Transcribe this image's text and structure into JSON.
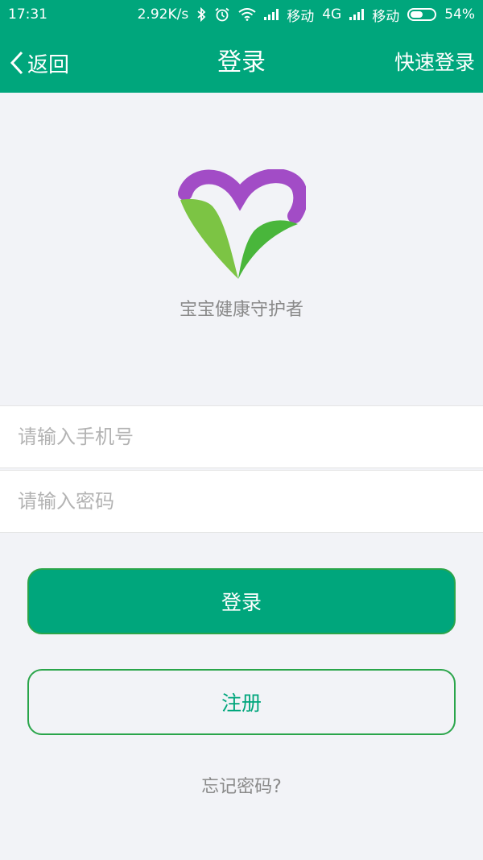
{
  "status_bar": {
    "time": "17:31",
    "speed": "2.92K/s",
    "carrier1": "移动",
    "network1": "4G",
    "carrier2": "移动",
    "battery": "54%",
    "battery_level": 0.54,
    "icons": [
      "bluetooth-icon",
      "alarm-icon",
      "wifi-icon",
      "signal-icon",
      "battery-icon"
    ]
  },
  "nav": {
    "back_label": "返回",
    "title": "登录",
    "quick_login_label": "快速登录"
  },
  "brand": {
    "slogan": "宝宝健康守护者",
    "colors": {
      "heart_purple": "#a24cc6",
      "leaf_green": "#49b63b"
    }
  },
  "form": {
    "phone_placeholder": "请输入手机号",
    "phone_value": "",
    "password_placeholder": "请输入密码",
    "password_value": ""
  },
  "actions": {
    "login_label": "登录",
    "register_label": "注册",
    "forgot_label": "忘记密码?"
  },
  "theme": {
    "primary": "#00a67c",
    "background": "#f2f3f7"
  }
}
